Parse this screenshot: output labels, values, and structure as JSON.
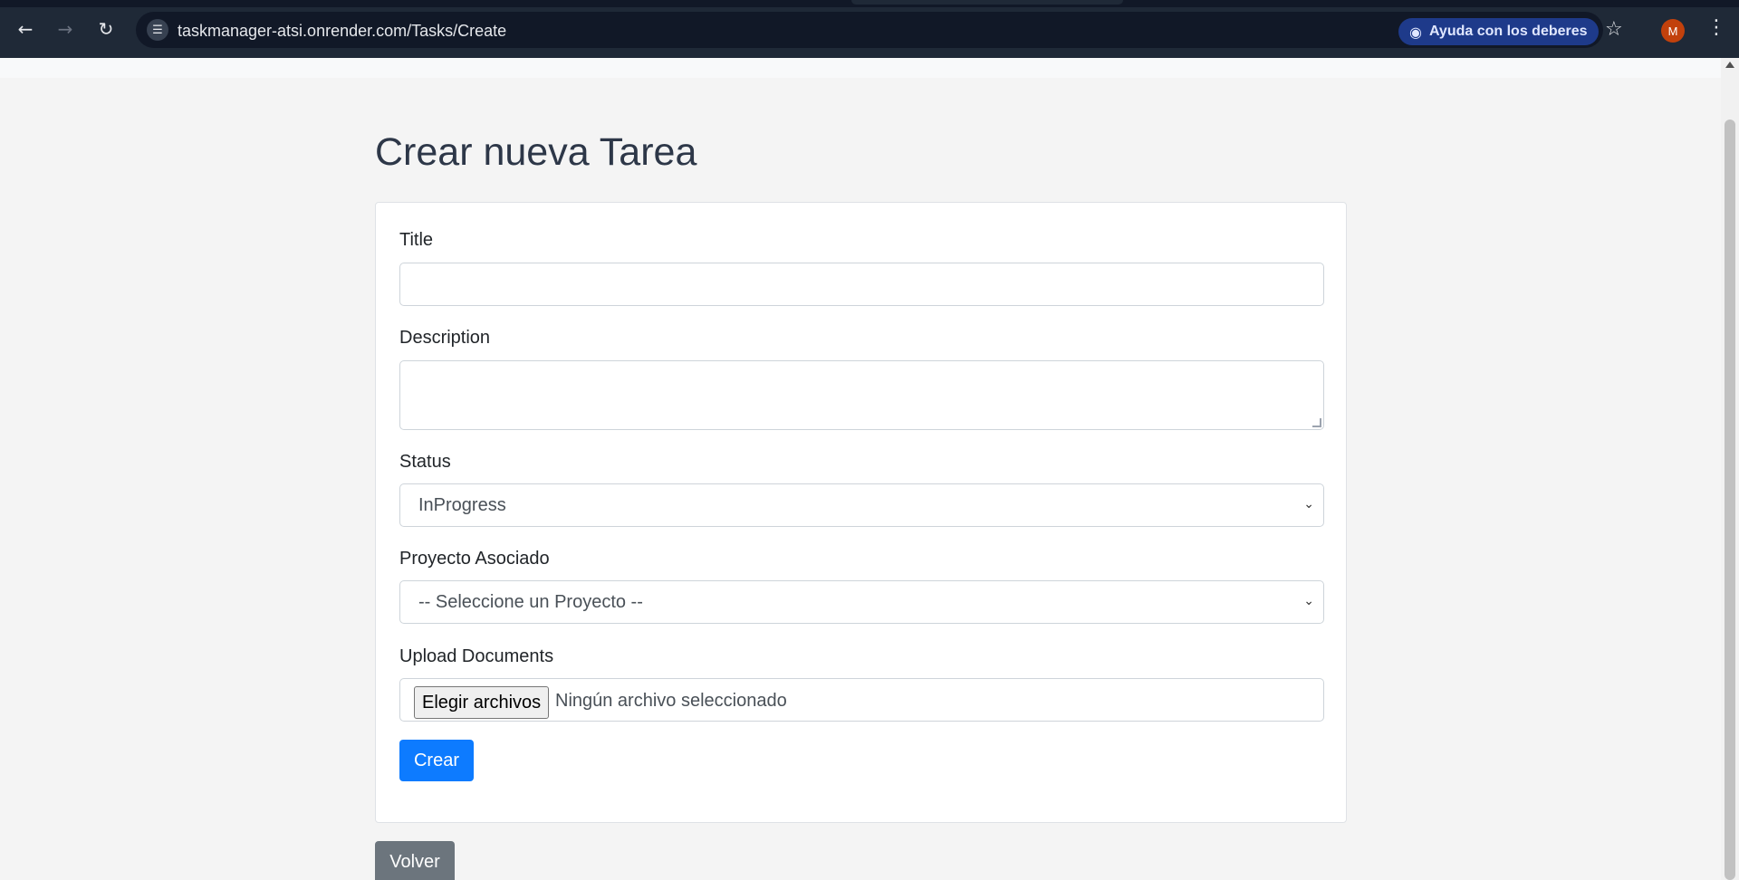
{
  "browser": {
    "url": "taskmanager-atsi.onrender.com/Tasks/Create",
    "lens_label": "Ayuda con los deberes",
    "profile_initial": "M",
    "icons": {
      "back": "arrow-left-icon",
      "forward": "arrow-right-icon",
      "reload": "reload-icon",
      "site_info": "tune-icon",
      "lens": "lens-icon",
      "bookmark": "star-icon",
      "menu": "kebab-icon"
    }
  },
  "page": {
    "title": "Crear nueva Tarea"
  },
  "form": {
    "title_label": "Title",
    "title_value": "",
    "description_label": "Description",
    "description_value": "",
    "status_label": "Status",
    "status_selected": "InProgress",
    "project_label": "Proyecto Asociado",
    "project_selected": "-- Seleccione un Proyecto --",
    "upload_label": "Upload Documents",
    "file_button": "Elegir archivos",
    "file_status": "Ningún archivo seleccionado",
    "submit_label": "Crear"
  },
  "back_button": "Volver",
  "colors": {
    "primary": "#0d7bff",
    "secondary": "#6c757d",
    "chrome": "#1f2937"
  }
}
